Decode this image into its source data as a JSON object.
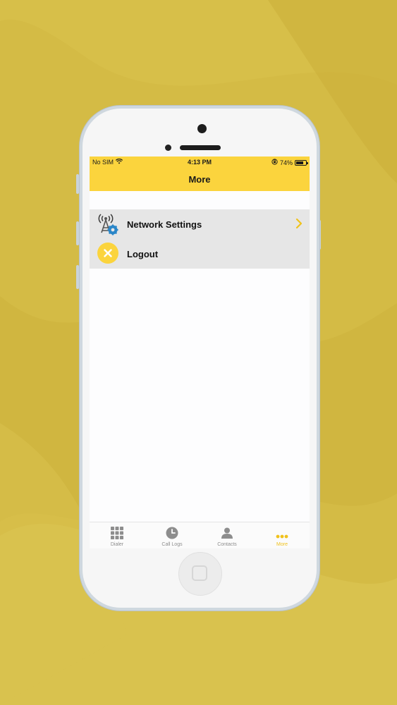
{
  "colors": {
    "background": "#d4bb45",
    "accent": "#fbd43d",
    "active_tab": "#f0c21c",
    "inactive_tab": "#8d8d8d",
    "menu_bg": "#e6e6e6"
  },
  "status_bar": {
    "carrier": "No SIM",
    "time": "4:13 PM",
    "battery_percent": "74%",
    "battery_level": 0.74,
    "icons": [
      "wifi-icon",
      "orientation-lock-icon",
      "battery-icon"
    ]
  },
  "nav": {
    "title": "More"
  },
  "menu": {
    "items": [
      {
        "label": "Network Settings",
        "icon": "network-settings-icon",
        "has_chevron": true
      },
      {
        "label": "Logout",
        "icon": "logout-icon",
        "has_chevron": false
      }
    ]
  },
  "tabbar": {
    "tabs": [
      {
        "label": "Dialer",
        "icon": "keypad-icon",
        "active": false
      },
      {
        "label": "Call Logs",
        "icon": "clock-icon",
        "active": false
      },
      {
        "label": "Contacts",
        "icon": "contacts-icon",
        "active": false
      },
      {
        "label": "More",
        "icon": "more-dots-icon",
        "active": true
      }
    ]
  }
}
